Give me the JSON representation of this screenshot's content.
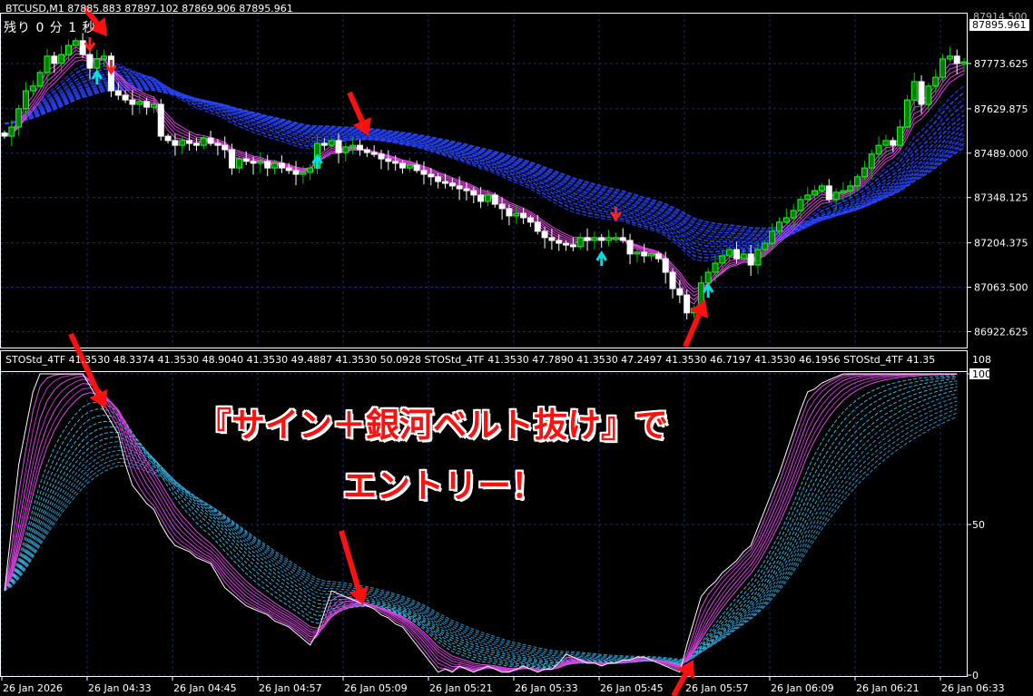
{
  "header": {
    "symbol_line": "BTCUSD,M1  87885.883 87897.102 87869.906 87895.961",
    "timer": "残り 0 分 1 秒",
    "last_price": "87895.961",
    "top_price_partial": "87914.500"
  },
  "indicator_header": "STOStd_4TF 41.3530 48.3374 41.3530 48.9040 41.3530 49.4887 41.3530 50.0928  STOStd_4TF 41.3530 47.7890 41.3530 47.2497 41.3530 46.7197 41.3530 46.1956  STOStd_4TF 41.35",
  "overlay": {
    "line1": "『サイン＋銀河ベルト抜け』で",
    "line2": "エントリー！"
  },
  "colors": {
    "background": "#000000",
    "bull": "#00c000",
    "bear": "#ffffff",
    "ma_band": "#e040e0",
    "galaxy_band": "#2040ff",
    "stoch_band": "#40c0e0",
    "signal_down": "#ff2020",
    "signal_up": "#00e0e0",
    "annotation": "#ff1010",
    "grid": "#1a2a6a"
  },
  "chart_data": [
    {
      "type": "candlestick",
      "title": "BTCUSD,M1",
      "ylim": [
        86872,
        87932
      ],
      "y_ticks": [
        "87773.625",
        "87629.875",
        "87489.000",
        "87348.125",
        "87204.375",
        "87063.500",
        "86922.625"
      ],
      "x_ticks": [
        "26 Jan 2026",
        "26 Jan 04:33",
        "26 Jan 04:45",
        "26 Jan 04:57",
        "26 Jan 05:09",
        "26 Jan 05:21",
        "26 Jan 05:33",
        "26 Jan 05:45",
        "26 Jan 05:57",
        "26 Jan 06:09",
        "26 Jan 06:21",
        "26 Jan 06:33"
      ],
      "grid": true,
      "closes": [
        87543,
        87572,
        87630,
        87687,
        87702,
        87745,
        87797,
        87774,
        87802,
        87831,
        87846,
        87802,
        87759,
        87788,
        87797,
        87687,
        87673,
        87658,
        87644,
        87653,
        87635,
        87644,
        87543,
        87529,
        87514,
        87529,
        87520,
        87514,
        87537,
        87520,
        87514,
        87500,
        87442,
        87471,
        87463,
        87457,
        87463,
        87442,
        87457,
        87442,
        87434,
        87422,
        87428,
        87442,
        87520,
        87514,
        87529,
        87491,
        87509,
        87514,
        87500,
        87491,
        87486,
        87471,
        87463,
        87457,
        87442,
        87451,
        87434,
        87422,
        87414,
        87399,
        87394,
        87385,
        87376,
        87370,
        87356,
        87336,
        87356,
        87327,
        87313,
        87290,
        87298,
        87284,
        87270,
        87241,
        87221,
        87212,
        87203,
        87198,
        87192,
        87221,
        87212,
        87221,
        87212,
        87221,
        87221,
        87212,
        87169,
        87175,
        87163,
        87169,
        87154,
        87111,
        87059,
        87039,
        86982,
        86996,
        87077,
        87111,
        87140,
        87163,
        87183,
        87154,
        87169,
        87134,
        87183,
        87203,
        87241,
        87270,
        87284,
        87307,
        87342,
        87356,
        87370,
        87385,
        87342,
        87365,
        87370,
        87385,
        87414,
        87442,
        87486,
        87514,
        87529,
        87514,
        87572,
        87658,
        87716,
        87644,
        87702,
        87730,
        87788,
        87797,
        87774,
        87779
      ],
      "signals": [
        {
          "bar": 12,
          "type": "sell"
        },
        {
          "bar": 15,
          "type": "sell"
        },
        {
          "bar": 13,
          "type": "buy"
        },
        {
          "bar": 44,
          "type": "buy"
        },
        {
          "bar": 84,
          "type": "buy"
        },
        {
          "bar": 86,
          "type": "sell"
        },
        {
          "bar": 99,
          "type": "buy"
        }
      ]
    },
    {
      "type": "line",
      "title": "STOStd_4TF",
      "ylim": [
        0,
        108
      ],
      "y_ticks": [
        "108",
        "100",
        "50",
        "0"
      ],
      "grid": true,
      "main_line": [
        28,
        49,
        70,
        82,
        94,
        100,
        100,
        100,
        100,
        100,
        100,
        100,
        96,
        92,
        88,
        84,
        80,
        70,
        63,
        60,
        57,
        55,
        50,
        46,
        43,
        42,
        41,
        39,
        38,
        37,
        33,
        29,
        27,
        25,
        23,
        22,
        21,
        20,
        18,
        17,
        16,
        14,
        12,
        10,
        14,
        21,
        28,
        27,
        26,
        25,
        24,
        23,
        22,
        20,
        19,
        17,
        16,
        13,
        10,
        7,
        4,
        1,
        2,
        1,
        3,
        2,
        1,
        2,
        3,
        2,
        1,
        1,
        2,
        3,
        2,
        1,
        2,
        2,
        4,
        7,
        6,
        5,
        4,
        4,
        3,
        4,
        4,
        5,
        5,
        6,
        6,
        5,
        4,
        3,
        2,
        1,
        10,
        18,
        26,
        29,
        31,
        34,
        36,
        38,
        41,
        43,
        49,
        55,
        61,
        67,
        74,
        81,
        88,
        94,
        95,
        97,
        98,
        99,
        100,
        100,
        100,
        100,
        100,
        100,
        100,
        100,
        100,
        100,
        100,
        100,
        100,
        100,
        100,
        100,
        100
      ]
    }
  ]
}
